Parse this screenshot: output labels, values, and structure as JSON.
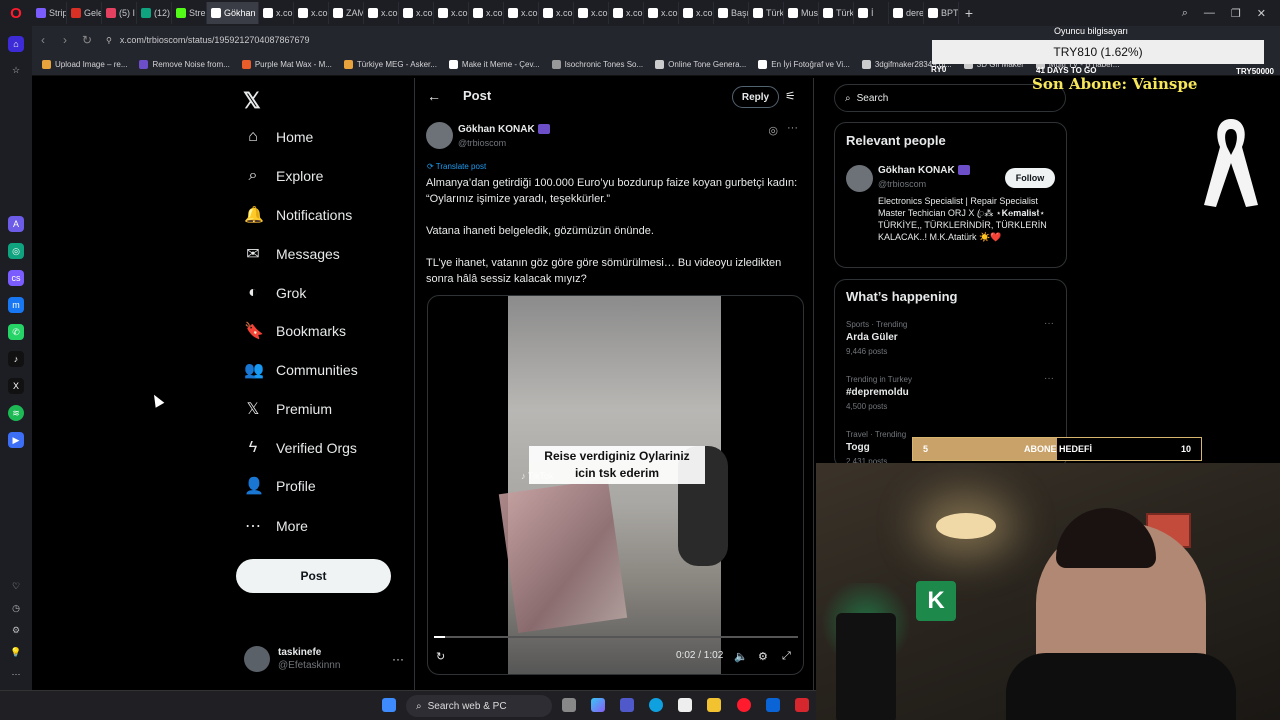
{
  "browser": {
    "tabs": [
      {
        "label": "Strip",
        "color": "#7b5cff"
      },
      {
        "label": "Gele",
        "color": "#d93025"
      },
      {
        "label": "(5) I",
        "color": "#e4405f"
      },
      {
        "label": "(12)",
        "color": "#10a37f"
      },
      {
        "label": "Stre",
        "color": "#53fc18"
      },
      {
        "label": "Gökhan",
        "color": "#ffffff",
        "active": true
      },
      {
        "label": "x.co",
        "color": "#ffffff"
      },
      {
        "label": "x.co",
        "color": "#ffffff"
      },
      {
        "label": "ZAM",
        "color": "#ffffff"
      },
      {
        "label": "x.co",
        "color": "#ffffff"
      },
      {
        "label": "x.co",
        "color": "#ffffff"
      },
      {
        "label": "x.co",
        "color": "#ffffff"
      },
      {
        "label": "x.co",
        "color": "#ffffff"
      },
      {
        "label": "x.co",
        "color": "#ffffff"
      },
      {
        "label": "x.co",
        "color": "#ffffff"
      },
      {
        "label": "x.co",
        "color": "#ffffff"
      },
      {
        "label": "x.co",
        "color": "#ffffff"
      },
      {
        "label": "x.co",
        "color": "#ffffff"
      },
      {
        "label": "x.co",
        "color": "#ffffff"
      },
      {
        "label": "Başı",
        "color": "#ffffff"
      },
      {
        "label": "Türk",
        "color": "#ffffff"
      },
      {
        "label": "Mus",
        "color": "#ffffff"
      },
      {
        "label": "Türk",
        "color": "#ffffff"
      },
      {
        "label": "İ",
        "color": "#ffffff"
      },
      {
        "label": "dere",
        "color": "#ffffff"
      },
      {
        "label": "BPT",
        "color": "#ffffff"
      }
    ],
    "url": "x.com/trbioscom/status/1959212704087867679",
    "bookmarks": [
      {
        "label": "Upload Image – re...",
        "color": "#e8a33d"
      },
      {
        "label": "Remove Noise from...",
        "color": "#6b4ec8"
      },
      {
        "label": "Purple Mat Wax - M...",
        "color": "#e85d2a"
      },
      {
        "label": "Türkiye MEG - Asker...",
        "color": "#e8a33d"
      },
      {
        "label": "Make it Meme - Çev...",
        "color": "#ffffff"
      },
      {
        "label": "Isochronic Tones So...",
        "color": "#999999"
      },
      {
        "label": "Online Tone Genera...",
        "color": "#cccccc"
      },
      {
        "label": "En İyi Fotoğraf ve Vi...",
        "color": "#ffffff"
      },
      {
        "label": "3dgifmaker28349.gi...",
        "color": "#cccccc"
      },
      {
        "label": "3D Gif Maker",
        "color": "#cccccc"
      },
      {
        "label": "Multi TV - B haber...",
        "color": "#cccccc"
      }
    ]
  },
  "nav": {
    "items": [
      {
        "label": "Home",
        "icon": "home-icon",
        "glyph": "⌂"
      },
      {
        "label": "Explore",
        "icon": "search-icon",
        "glyph": "⌕"
      },
      {
        "label": "Notifications",
        "icon": "bell-icon",
        "glyph": "🔔"
      },
      {
        "label": "Messages",
        "icon": "mail-icon",
        "glyph": "✉"
      },
      {
        "label": "Grok",
        "icon": "grok-icon",
        "glyph": "◐"
      },
      {
        "label": "Bookmarks",
        "icon": "bookmark-icon",
        "glyph": "🔖"
      },
      {
        "label": "Communities",
        "icon": "communities-icon",
        "glyph": "👥"
      },
      {
        "label": "Premium",
        "icon": "x-premium-icon",
        "glyph": "𝕏"
      },
      {
        "label": "Verified Orgs",
        "icon": "lightning-icon",
        "glyph": "ϟ"
      },
      {
        "label": "Profile",
        "icon": "profile-icon",
        "glyph": "👤"
      },
      {
        "label": "More",
        "icon": "more-circle-icon",
        "glyph": "⋯"
      }
    ],
    "post_button": "Post",
    "account": {
      "name": "taskinefe",
      "handle": "@Efetaskinnn"
    }
  },
  "post": {
    "header_title": "Post",
    "reply_label": "Reply",
    "author_name": "Gökhan KONAK",
    "author_handle": "@trbioscom",
    "translate": "Translate post",
    "paragraphs": [
      "Almanya’dan getirdiği 100.000 Euro’yu bozdurup faize koyan gurbetçi kadın: “Oylarınız işimize yaradı, teşekkürler.”",
      "Vatana ihaneti belgeledik, gözümüzün önünde.",
      "TL’ye ihanet, vatanın göz göre göre sömürülmesi… Bu videoyu izledikten sonra hâlâ sessiz kalacak mıyız?"
    ],
    "video": {
      "caption": "Reise verdiginiz Oylariniz icin tsk ederim",
      "watermark": "TikTok",
      "time": "0:02 / 1:02",
      "progress": 0.03
    }
  },
  "sidebar": {
    "search_placeholder": "Search",
    "relevant": {
      "title": "Relevant people",
      "name": "Gökhan KONAK",
      "handle": "@trbioscom",
      "follow": "Follow",
      "bio": "Electronics Specialist | Repair Specialist Master Techician ORJ X ꦿ⁂ ⋆𝐊𝐞𝐦𝐚𝐥𝐢𝐬𝐭⋆ TÜRKİYE,, TÜRKLERİNDİR, TÜRKLERİN KALACAK..! M.K.Atatürk ☀️❤️"
    },
    "happening": {
      "title": "What’s happening",
      "trends": [
        {
          "meta": "Sports · Trending",
          "name": "Arda Güler",
          "count": "9,446 posts"
        },
        {
          "meta": "Trending in Turkey",
          "name": "#depremoldu",
          "count": "4,500 posts"
        },
        {
          "meta": "Travel · Trending",
          "name": "Togg",
          "count": "2,431 posts"
        }
      ]
    }
  },
  "overlay": {
    "oyuncu": "Oyuncu bilgisayarı",
    "price": "TRY810 (1.62%)",
    "left_label": "RY0",
    "days_label": "41 DAYS TO GO",
    "right_label": "TRY50000",
    "son_abone": "Son Abone: Vainspe",
    "goal_left": "5",
    "goal_mid": "ABONE HEDEFİ",
    "goal_right": "10"
  },
  "taskbar": {
    "search": "Search web & PC"
  }
}
